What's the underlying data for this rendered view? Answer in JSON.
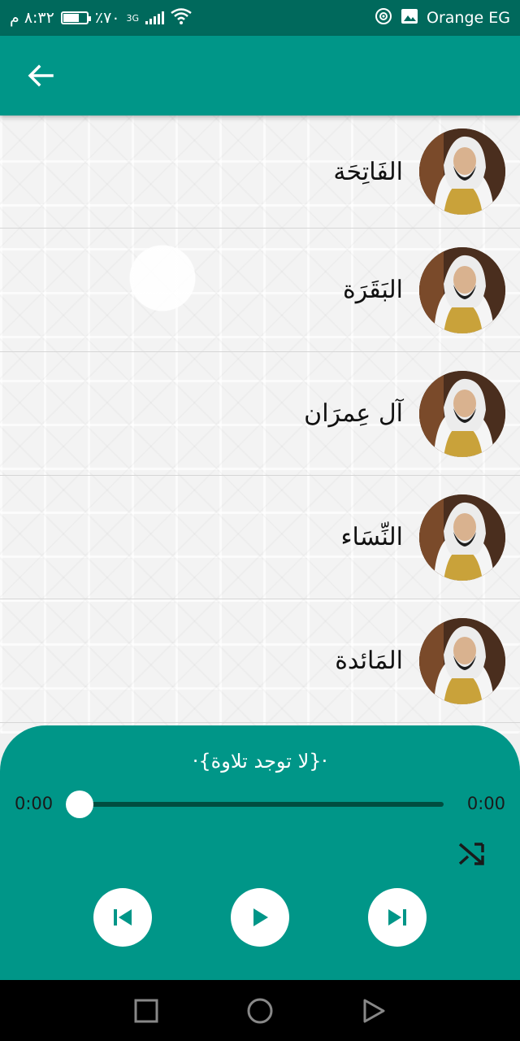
{
  "status_bar": {
    "time": "٨:٣٢ م",
    "battery": "٪٧٠",
    "battery_level": 0.7,
    "network_type": "3G",
    "carrier": "Orange EG"
  },
  "app_bar": {
    "back_icon": "arrow-back-icon"
  },
  "surahs": [
    {
      "name": "الفَاتِحَة"
    },
    {
      "name": "البَقَرَة"
    },
    {
      "name": "آل عِمرَان"
    },
    {
      "name": "النِّسَاء"
    },
    {
      "name": "المَائدة"
    }
  ],
  "player": {
    "title": "·{لا توجد تلاوة}·",
    "current_time": "0:00",
    "total_time": "0:00",
    "progress": 0,
    "icons": {
      "shuffle": "shuffle-icon",
      "previous": "skip-previous-icon",
      "play": "play-icon",
      "next": "skip-next-icon"
    }
  },
  "nav_bar": {
    "icons": [
      "recents-square-icon",
      "home-circle-icon",
      "back-triangle-icon"
    ]
  },
  "colors": {
    "status_bar": "#00695c",
    "primary": "#009688",
    "seek_track": "#004d40"
  }
}
